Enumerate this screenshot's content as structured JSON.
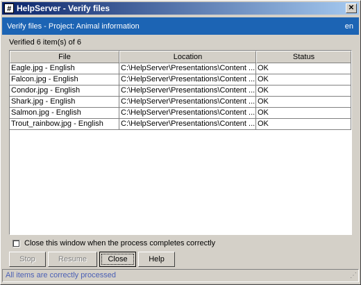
{
  "window": {
    "title": "HelpServer - Verify files",
    "close_glyph": "✕",
    "app_icon_glyph": "#"
  },
  "header": {
    "text": "Verify files - Project: Animal information",
    "lang": "en"
  },
  "summary": "Verified 6 item(s) of 6",
  "table": {
    "columns": [
      "File",
      "Location",
      "Status"
    ],
    "rows": [
      {
        "file": "Eagle.jpg - English",
        "location": "C:\\HelpServer\\Presentations\\Content ...",
        "status": "OK"
      },
      {
        "file": "Falcon.jpg - English",
        "location": "C:\\HelpServer\\Presentations\\Content ...",
        "status": "OK"
      },
      {
        "file": "Condor.jpg - English",
        "location": "C:\\HelpServer\\Presentations\\Content ...",
        "status": "OK"
      },
      {
        "file": "Shark.jpg - English",
        "location": "C:\\HelpServer\\Presentations\\Content ...",
        "status": "OK"
      },
      {
        "file": "Salmon.jpg - English",
        "location": "C:\\HelpServer\\Presentations\\Content ...",
        "status": "OK"
      },
      {
        "file": "Trout_rainbow.jpg - English",
        "location": "C:\\HelpServer\\Presentations\\Content ...",
        "status": "OK"
      }
    ]
  },
  "checkbox_label": "Close this window when the process completes correctly",
  "buttons": {
    "stop": "Stop",
    "resume": "Resume",
    "close": "Close",
    "help": "Help"
  },
  "status": "All items are correctly processed",
  "colors": {
    "header_band": "#1c64b4",
    "status_text": "#4a5fb5"
  }
}
